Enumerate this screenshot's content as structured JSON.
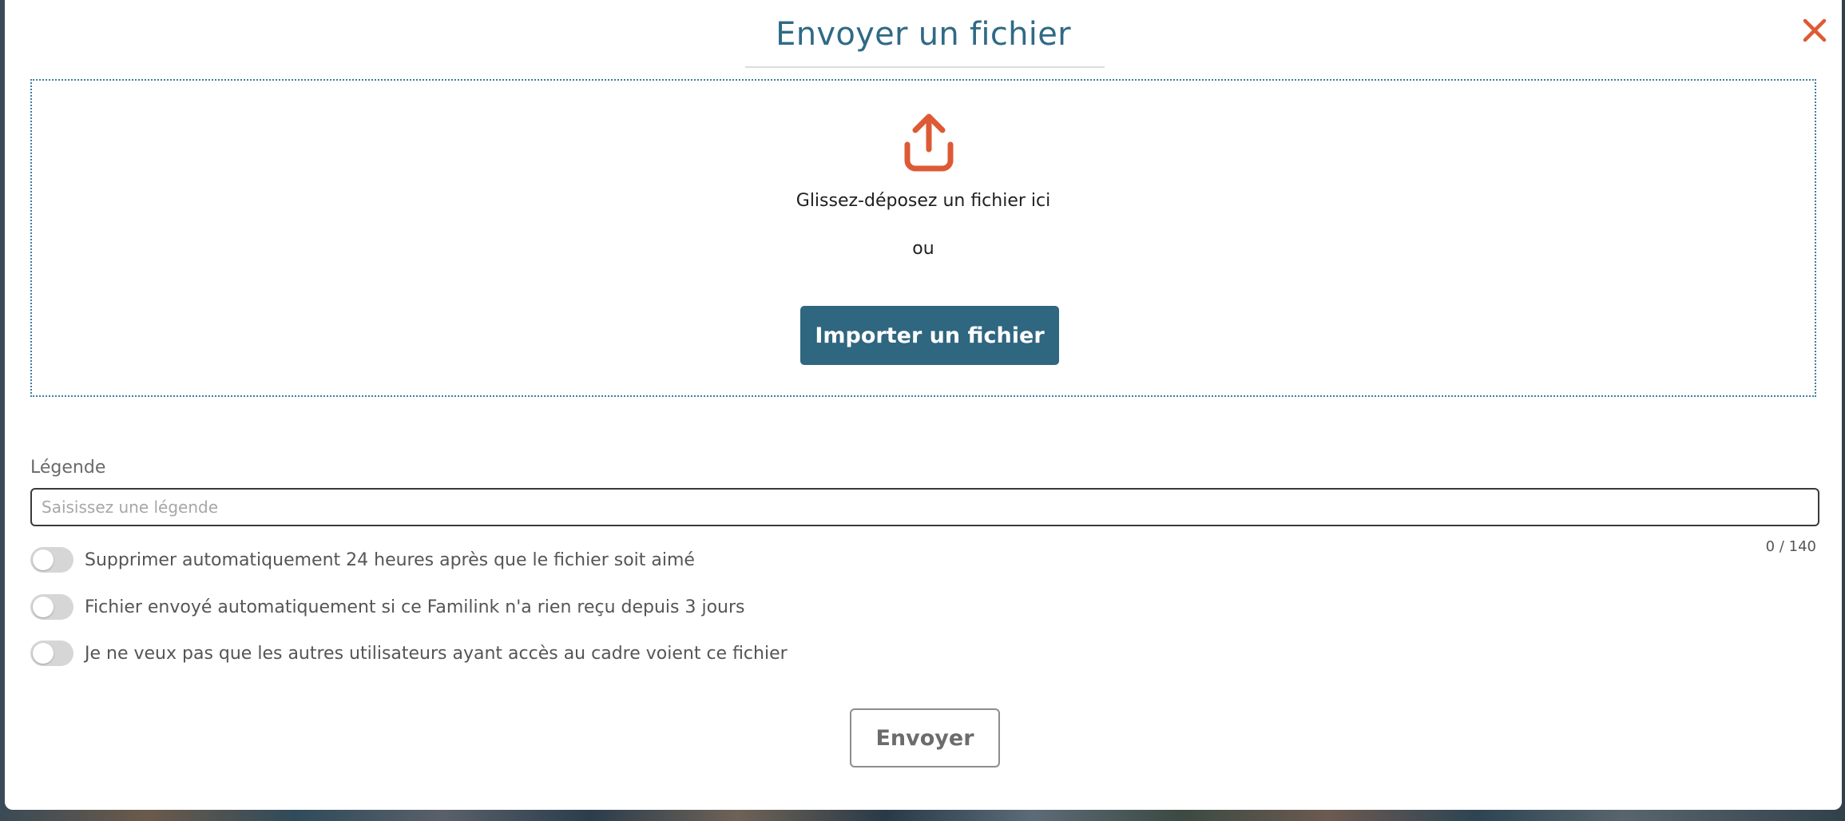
{
  "modal": {
    "title": "Envoyer un fichier",
    "close_icon": "close-icon"
  },
  "dropzone": {
    "icon": "upload-icon",
    "drop_text": "Glissez-déposez un fichier ici",
    "or_text": "ou",
    "import_button_label": "Importer un fichier"
  },
  "caption": {
    "label": "Légende",
    "placeholder": "Saisissez une légende",
    "value": "",
    "counter": "0 / 140"
  },
  "options": [
    {
      "label": "Supprimer automatiquement 24 heures après que le fichier soit aimé",
      "enabled": false
    },
    {
      "label": "Fichier envoyé automatiquement si ce Familink n'a rien reçu depuis 3 jours",
      "enabled": false
    },
    {
      "label": "Je ne veux pas que les autres utilisateurs ayant accès au cadre voient ce fichier",
      "enabled": false
    }
  ],
  "actions": {
    "send_label": "Envoyer"
  },
  "colors": {
    "title": "#2f6a86",
    "accent_orange": "#dd5a35",
    "primary_button": "#2f6680"
  }
}
